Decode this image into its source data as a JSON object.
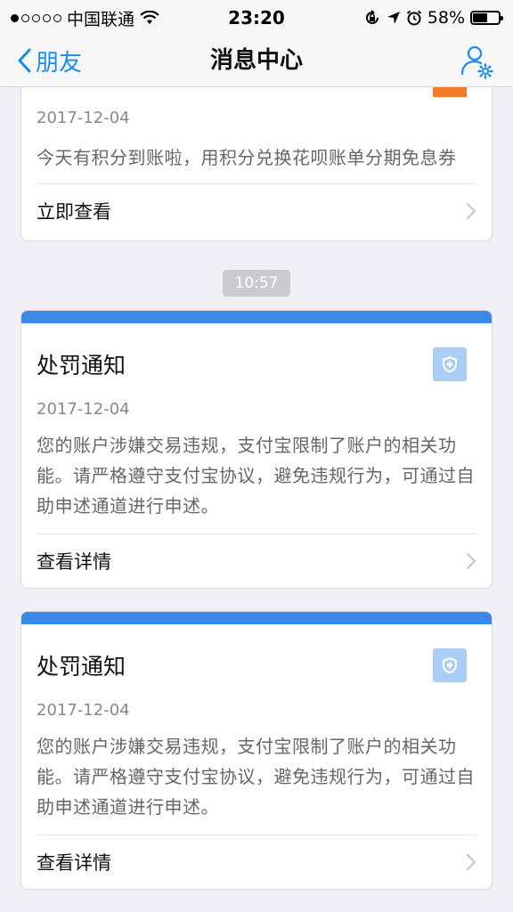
{
  "status": {
    "carrier": "中国联通",
    "time": "23:20",
    "battery": "58%",
    "battery_level": 0.58
  },
  "nav": {
    "back_label": "朋友",
    "title": "消息中心"
  },
  "messages": [
    {
      "date": "2017-12-04",
      "body": "今天有积分到账啦，用积分兑换花呗账单分期免息券",
      "action": "立即查看",
      "accent": "#f07c2e"
    },
    {
      "title": "处罚通知",
      "date": "2017-12-04",
      "body": "您的账户涉嫌交易违规，支付宝限制了账户的相关功能。请严格遵守支付宝协议，避免违规行为，可通过自助申述通道进行申述。",
      "action": "查看详情",
      "badge_icon": "shield-icon",
      "accent": "#3c8ae6"
    },
    {
      "title": "处罚通知",
      "date": "2017-12-04",
      "body": "您的账户涉嫌交易违规，支付宝限制了账户的相关功能。请严格遵守支付宝协议，避免违规行为，可通过自助申述通道进行申述。",
      "action": "查看详情",
      "badge_icon": "shield-icon",
      "accent": "#3c8ae6"
    }
  ],
  "timestamp_divider": "10:57",
  "colors": {
    "link_blue": "#1a8cf0",
    "card_blue": "#3c8ae6",
    "badge_bg": "#a9cdf4",
    "orange": "#f07c2e"
  }
}
